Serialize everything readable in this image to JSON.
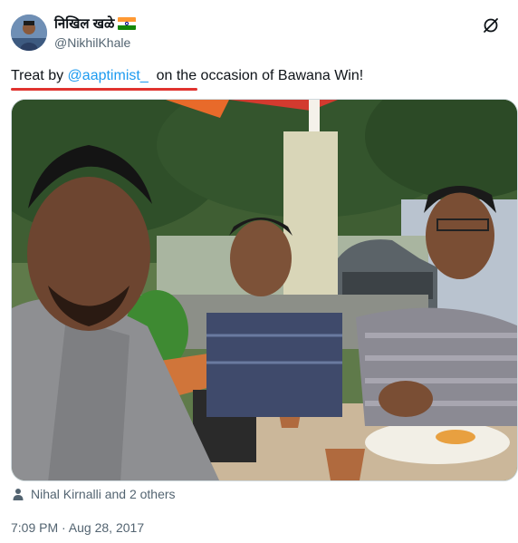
{
  "author": {
    "display_name": "निखिल खळे",
    "handle": "@NikhilKhale",
    "flag_icon": "india-flag-icon"
  },
  "header": {
    "grok_icon": "grok-icon",
    "more_icon": "more-icon"
  },
  "tweet": {
    "text_before": "Treat by ",
    "mention": "@aaptimist_",
    "text_after": "  on the occasion of Bawana Win!"
  },
  "media": {
    "type": "photo",
    "description_icon": "photo-image"
  },
  "tags": {
    "icon": "person-icon",
    "label": "Nihal Kirnalli and 2 others"
  },
  "meta": {
    "timestamp": "7:09 PM · Aug 28, 2017"
  },
  "colors": {
    "mention": "#1d9bf0",
    "secondary_text": "#536471",
    "underline_mark": "#e0332f"
  }
}
